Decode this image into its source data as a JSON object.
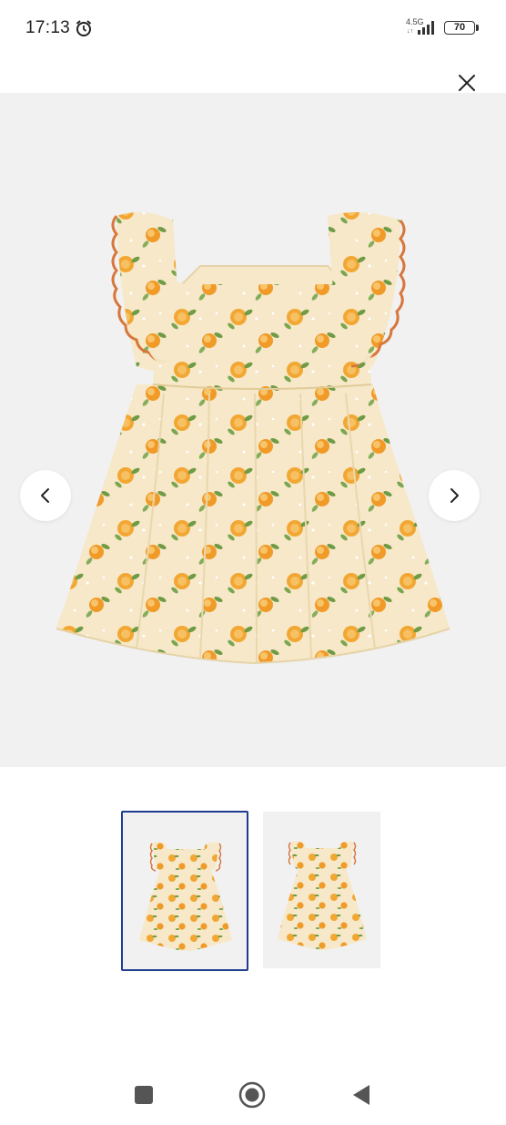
{
  "status_bar": {
    "time": "17:13",
    "network": "4.5G",
    "network_arrows": "↓↑",
    "battery": "70",
    "icons": [
      "alarm-icon",
      "signal-icon",
      "battery-icon"
    ]
  },
  "viewer": {
    "close_icon": "close-icon",
    "prev_icon": "chevron-left-icon",
    "next_icon": "chevron-right-icon",
    "thumbnails_count": 2,
    "selected_thumbnail": 1
  },
  "colors": {
    "image_bg": "#f1f1f1",
    "dress_fabric": "#f6e8c8",
    "orange": "#f0a030",
    "trim": "#d7773c",
    "leaf": "#6f9b45",
    "selected_border": "#1f3c8f"
  },
  "system_nav": {
    "icons": [
      "recents-square-icon",
      "home-circle-icon",
      "back-triangle-icon"
    ]
  }
}
